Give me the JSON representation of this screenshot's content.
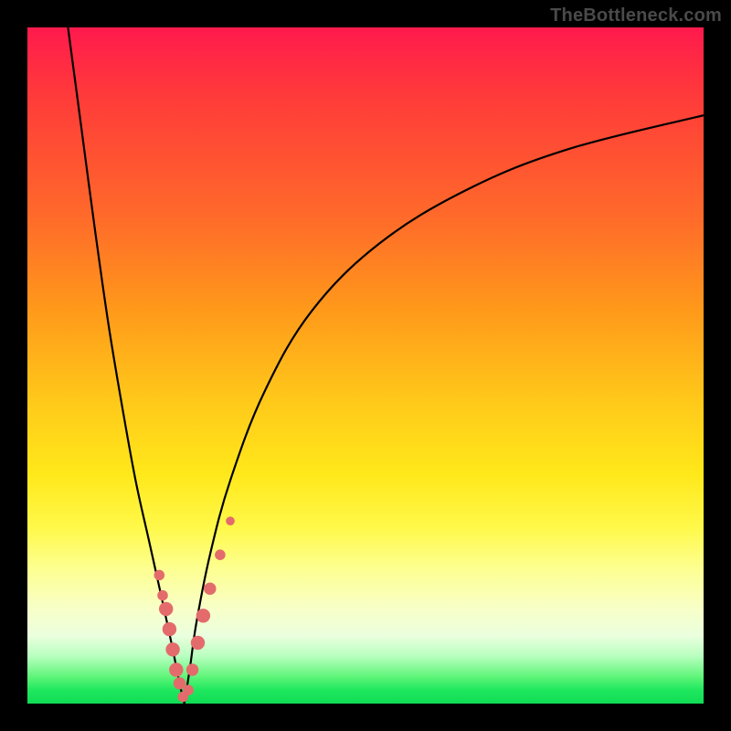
{
  "attribution": "TheBottleneck.com",
  "chart_data": {
    "type": "line",
    "title": "",
    "xlabel": "",
    "ylabel": "",
    "xlim": [
      0,
      100
    ],
    "ylim": [
      0,
      100
    ],
    "grid": false,
    "legend": false,
    "background_gradient_stops": [
      {
        "pos": 0,
        "color": "#ff1a4d"
      },
      {
        "pos": 28,
        "color": "#ff6a2a"
      },
      {
        "pos": 55,
        "color": "#ffc81a"
      },
      {
        "pos": 74,
        "color": "#fff94a"
      },
      {
        "pos": 90,
        "color": "#eaffde"
      },
      {
        "pos": 100,
        "color": "#0fdc55"
      }
    ],
    "series": [
      {
        "name": "left-branch",
        "x": [
          6,
          8,
          10,
          12,
          14,
          16,
          18,
          20,
          21.5,
          22.5,
          23.2
        ],
        "y": [
          100,
          85,
          70,
          56,
          44,
          33,
          24,
          15,
          8,
          3,
          0
        ]
      },
      {
        "name": "right-branch",
        "x": [
          23.2,
          24,
          25,
          27,
          30,
          35,
          42,
          52,
          65,
          80,
          100
        ],
        "y": [
          0,
          5,
          12,
          22,
          33,
          46,
          58,
          68,
          76,
          82,
          87
        ]
      }
    ],
    "markers": [
      {
        "name": "left-cluster",
        "color": "#e46b6b",
        "points": [
          {
            "x": 19.5,
            "y": 19,
            "r": 1.2
          },
          {
            "x": 20.0,
            "y": 16,
            "r": 1.2
          },
          {
            "x": 20.5,
            "y": 14,
            "r": 1.6
          },
          {
            "x": 21.0,
            "y": 11,
            "r": 1.6
          },
          {
            "x": 21.5,
            "y": 8,
            "r": 1.6
          },
          {
            "x": 22.0,
            "y": 5,
            "r": 1.6
          },
          {
            "x": 22.5,
            "y": 3,
            "r": 1.4
          },
          {
            "x": 23.0,
            "y": 1,
            "r": 1.2
          }
        ]
      },
      {
        "name": "right-cluster",
        "color": "#e46b6b",
        "points": [
          {
            "x": 23.8,
            "y": 2,
            "r": 1.2
          },
          {
            "x": 24.4,
            "y": 5,
            "r": 1.4
          },
          {
            "x": 25.2,
            "y": 9,
            "r": 1.6
          },
          {
            "x": 26.0,
            "y": 13,
            "r": 1.6
          },
          {
            "x": 27.0,
            "y": 17,
            "r": 1.4
          },
          {
            "x": 28.5,
            "y": 22,
            "r": 1.2
          },
          {
            "x": 30.0,
            "y": 27,
            "r": 1.0
          }
        ]
      }
    ]
  }
}
